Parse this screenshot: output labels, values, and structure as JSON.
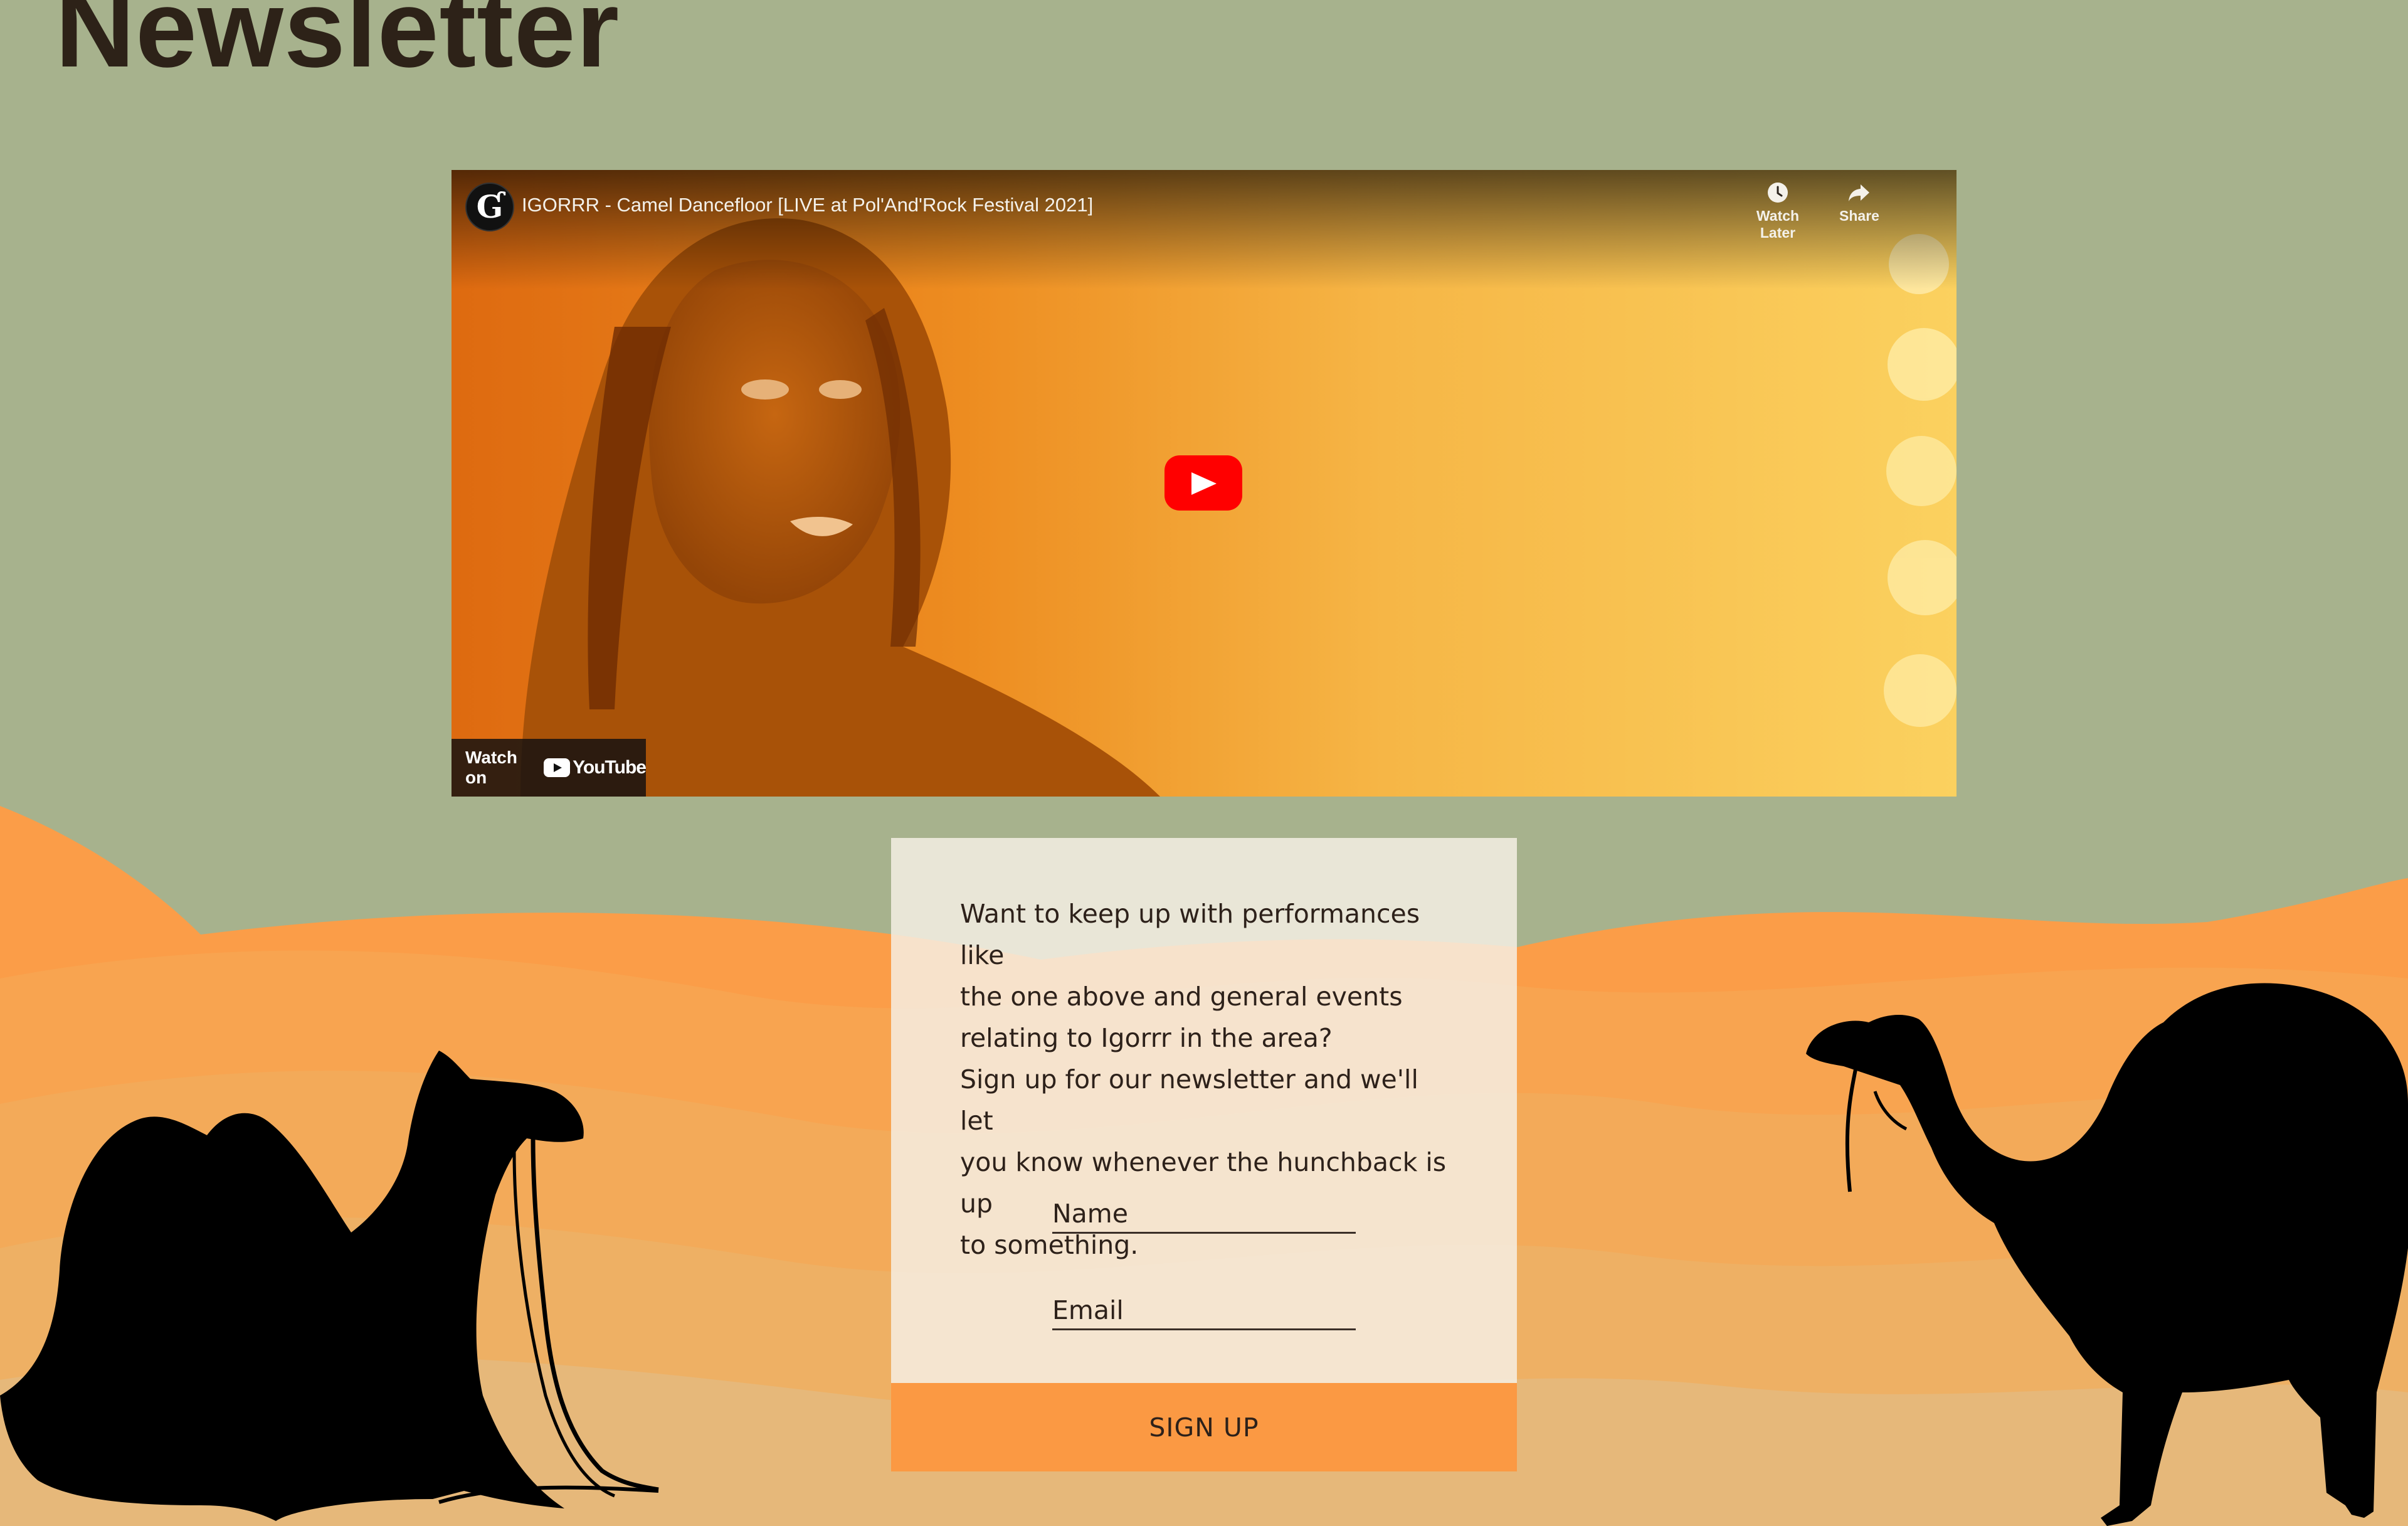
{
  "page": {
    "title": "Newsletter"
  },
  "video": {
    "title": "IGORRR - Camel Dancefloor [LIVE at Pol'And'Rock Festival 2021]",
    "channel_icon": "igorrr-channel-avatar",
    "watch_later_label": "Watch Later",
    "share_label": "Share",
    "watch_on_label": "Watch on",
    "youtube_label": "YouTube",
    "play_icon": "play-icon"
  },
  "newsletter": {
    "intro_line_1": "Want to keep up with performances like",
    "intro_line_2": "the one above and general events",
    "intro_line_3": "relating to Igorrr in the area?",
    "intro_line_4": "Sign up for our newsletter and we'll let",
    "intro_line_5": "you know whenever the hunchback is up",
    "intro_line_6": "to something.",
    "name_placeholder": "Name",
    "email_placeholder": "Email",
    "signup_label": "SIGN UP"
  },
  "colors": {
    "sky": "#a7b28d",
    "accent": "#fb9943",
    "card": "#f5efe5",
    "title": "#2d2218"
  }
}
